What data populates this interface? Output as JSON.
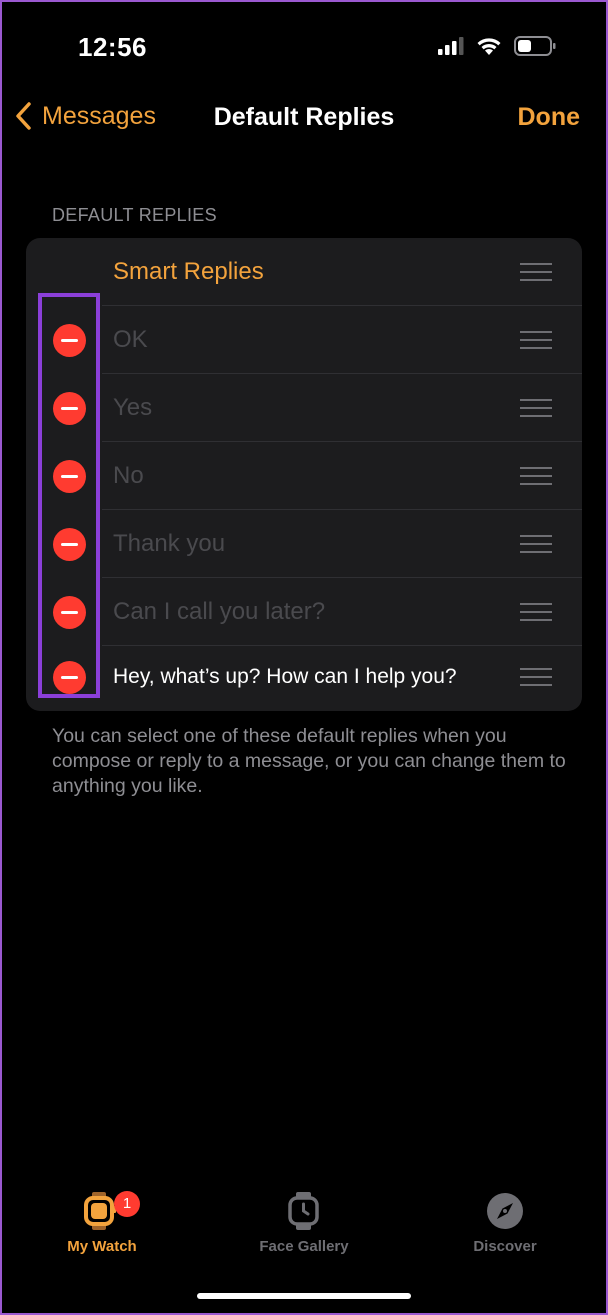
{
  "status_bar": {
    "time": "12:56"
  },
  "nav": {
    "back_label": "Messages",
    "title": "Default Replies",
    "done_label": "Done"
  },
  "section_header": "DEFAULT REPLIES",
  "smart_replies_label": "Smart Replies",
  "replies": [
    {
      "text": "OK"
    },
    {
      "text": "Yes"
    },
    {
      "text": "No"
    },
    {
      "text": "Thank you"
    },
    {
      "text": "Can I call you later?"
    },
    {
      "text": "Hey, what’s up? How can I help you?"
    }
  ],
  "footer_note": "You can select one of these default replies when you compose or reply to a message, or you can change them to anything you like.",
  "tabs": [
    {
      "label": "My Watch",
      "icon": "watch-icon",
      "badge": "1",
      "active": true
    },
    {
      "label": "Face Gallery",
      "icon": "watch-face-icon",
      "active": false
    },
    {
      "label": "Discover",
      "icon": "compass-icon",
      "active": false
    }
  ],
  "colors": {
    "accent": "#f3a33d",
    "delete": "#ff3b30",
    "highlight": "#8b3fd9"
  }
}
